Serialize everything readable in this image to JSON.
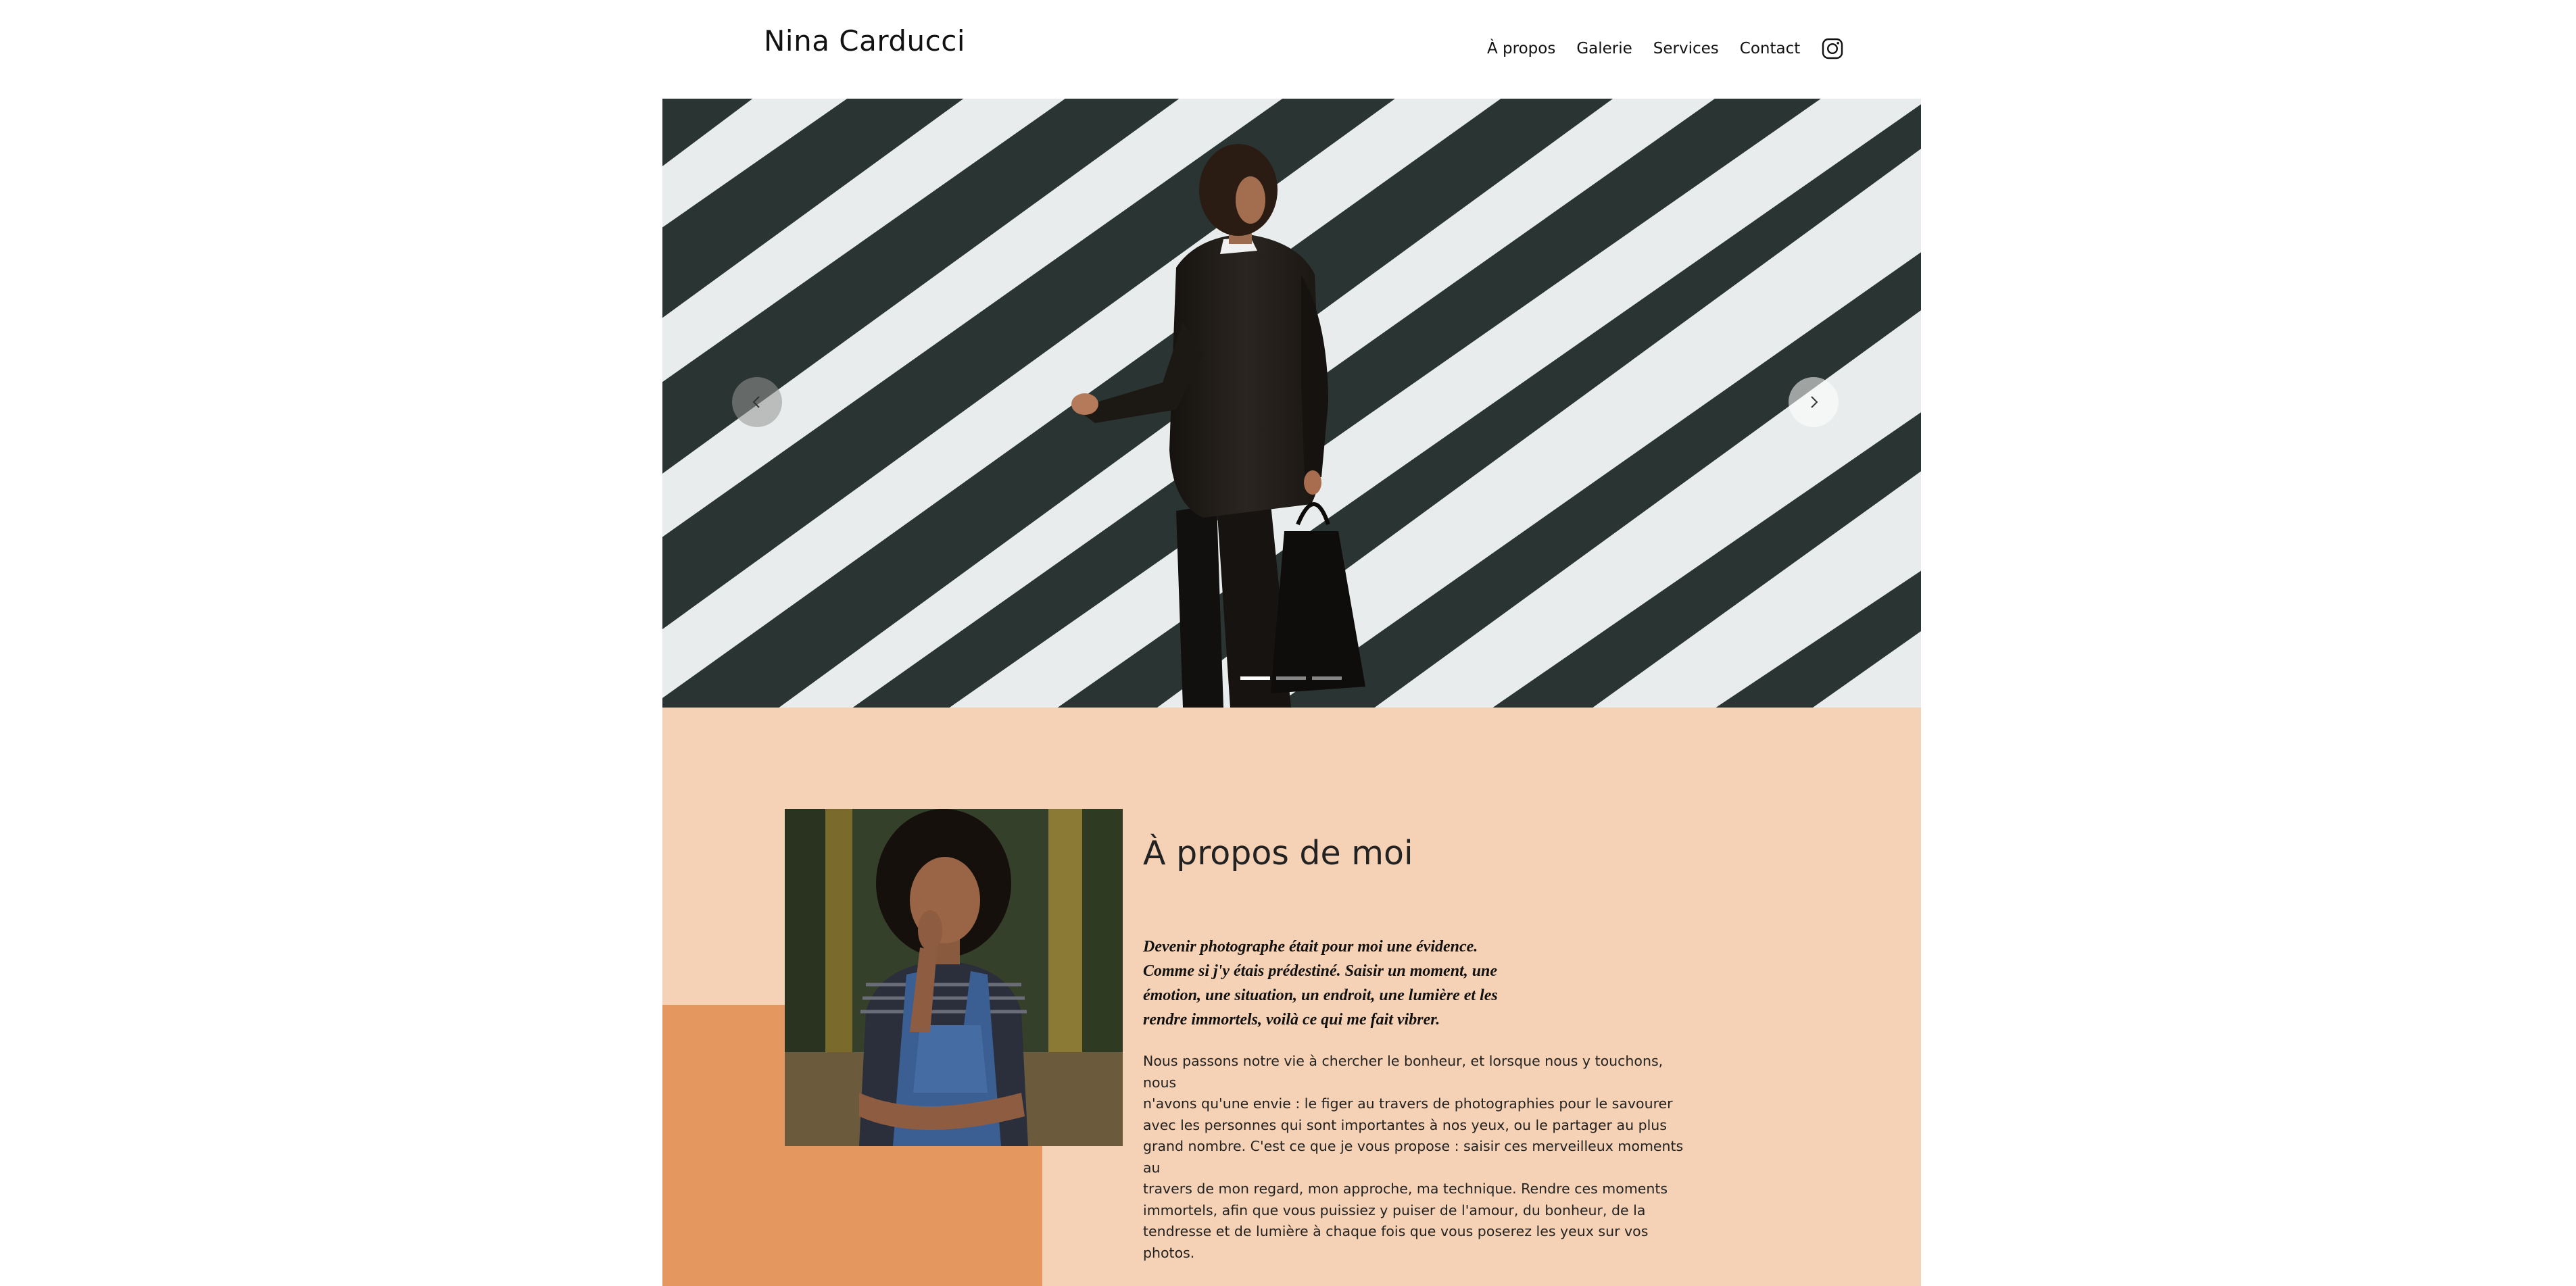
{
  "header": {
    "brand": "Nina Carducci",
    "nav": [
      {
        "label": "À propos"
      },
      {
        "label": "Galerie"
      },
      {
        "label": "Services"
      },
      {
        "label": "Contact"
      }
    ],
    "social_icon": "instagram-icon"
  },
  "hero": {
    "image": "man-in-suit-on-crosswalk",
    "prev_icon": "chevron-left-icon",
    "next_icon": "chevron-right-icon",
    "slides_total": 3,
    "active_slide": 1
  },
  "about": {
    "title": "À propos de moi",
    "quote_lines": [
      "Devenir photographe était pour moi une évidence.",
      "Comme si j'y étais prédestiné. Saisir un moment, une",
      "émotion, une situation, un endroit, une lumière et les",
      "rendre immortels, voilà ce qui me fait vibrer."
    ],
    "body_lines": [
      "Nous passons notre vie à chercher le bonheur, et lorsque nous y touchons, nous",
      "n'avons qu'une envie : le figer au travers de photographies pour le savourer",
      "avec les personnes qui sont importantes à nos yeux, ou le partager au plus",
      "grand nombre. C'est ce que je vous propose : saisir ces merveilleux moments au",
      "travers de mon regard, mon approche, ma technique. Rendre ces moments",
      "immortels, afin que vous puissiez y puiser de l'amour, du bonheur, de la",
      "tendresse et de lumière à chaque fois que vous poserez les yeux sur vos",
      "photos."
    ],
    "portrait": "woman-in-denim-overalls-portrait"
  },
  "colors": {
    "about_bg": "#f5d2b5",
    "about_accent": "#e4975f",
    "text": "#111111"
  }
}
